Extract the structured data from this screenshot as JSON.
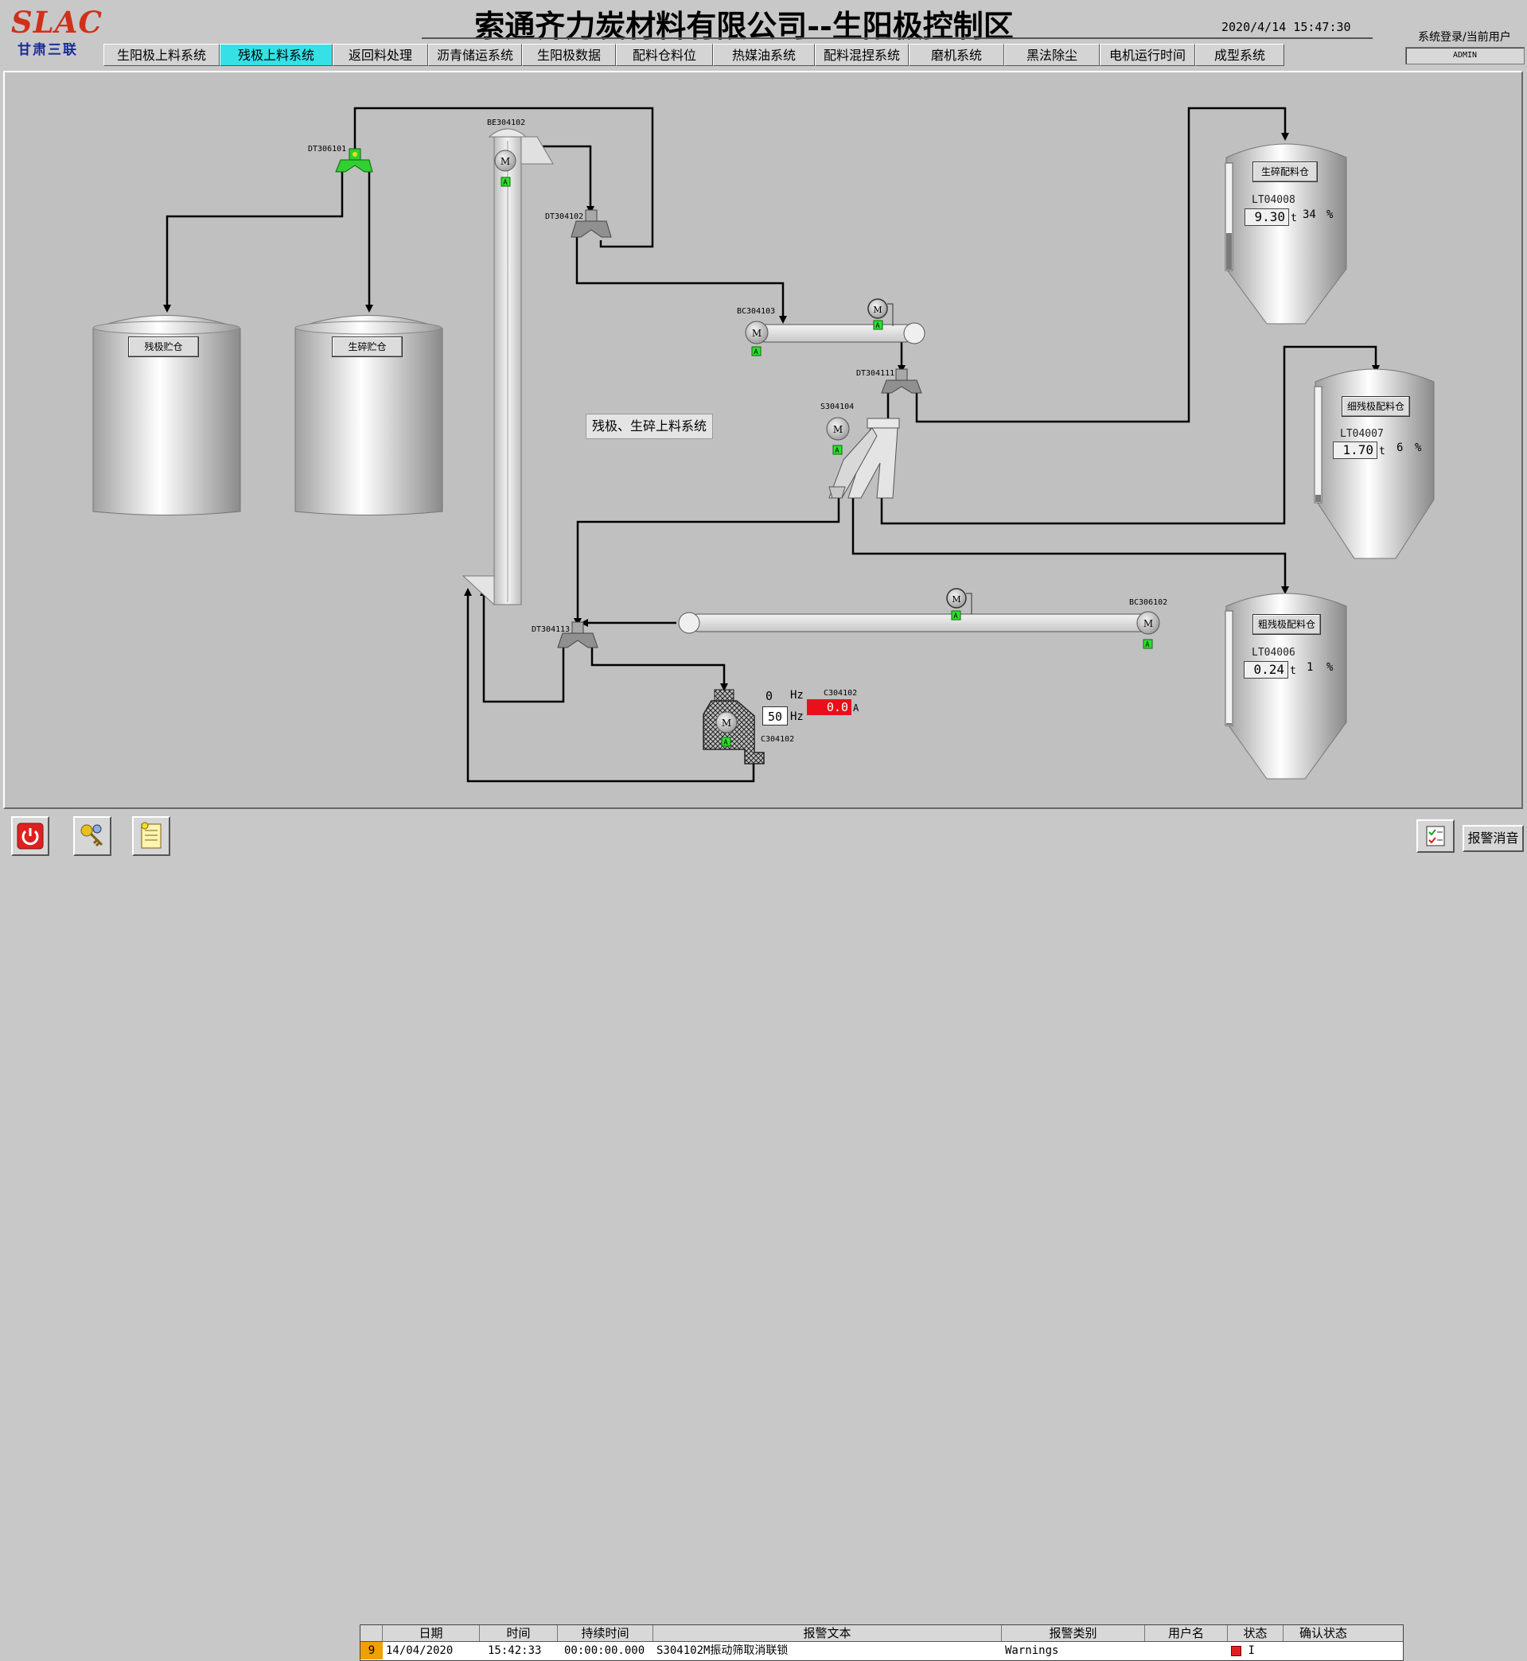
{
  "header": {
    "logo": "SLAC",
    "logo_sub": "甘肃三联",
    "title": "索通齐力炭材料有限公司--生阳极控制区",
    "datetime": "2020/4/14 15:47:30",
    "login_label": "系统登录/当前用户",
    "current_user": "ADMIN"
  },
  "tabs": [
    {
      "label": "生阳极上料系统",
      "active": false
    },
    {
      "label": "残极上料系统",
      "active": true
    },
    {
      "label": "返回料处理",
      "active": false
    },
    {
      "label": "沥青储运系统",
      "active": false
    },
    {
      "label": "生阳极数据",
      "active": false
    },
    {
      "label": "配料仓料位",
      "active": false
    },
    {
      "label": "热媒油系统",
      "active": false
    },
    {
      "label": "配料混捏系统",
      "active": false
    },
    {
      "label": "磨机系统",
      "active": false
    },
    {
      "label": "黑法除尘",
      "active": false
    },
    {
      "label": "电机运行时间",
      "active": false
    },
    {
      "label": "成型系统",
      "active": false
    }
  ],
  "equipment": {
    "dt306101": "DT306101",
    "be304102": "BE304102",
    "dt304102": "DT304102",
    "bc304103": "BC304103",
    "dt304111": "DT304111",
    "s304104": "S304104",
    "dt304113": "DT304113",
    "bc306102": "BC306102",
    "c304102_top": "C304102",
    "c304102_bottom": "C304102",
    "motor_letter": "M",
    "status_letter": "A"
  },
  "storage": {
    "bin1_label": "残极贮仓",
    "bin2_label": "生碎贮仓"
  },
  "system_label": "残极、生碎上料系统",
  "silos": [
    {
      "label": "生碎配料仓",
      "tag": "LT04008",
      "value": "9.30",
      "unit": "t",
      "percent": "34",
      "pct_unit": "%",
      "level": 0.34
    },
    {
      "label": "细残极配料仓",
      "tag": "LT04007",
      "value": "1.70",
      "unit": "t",
      "percent": "6",
      "pct_unit": "%",
      "level": 0.06
    },
    {
      "label": "粗残极配料仓",
      "tag": "LT04006",
      "value": "0.24",
      "unit": "t",
      "percent": "1",
      "pct_unit": "%",
      "level": 0.01
    }
  ],
  "crusher": {
    "freq_actual": "0",
    "freq_unit": "Hz",
    "freq_set": "50",
    "freq_set_unit": "Hz",
    "current": "0.0",
    "current_unit": "A"
  },
  "alarm": {
    "headers": [
      "日期",
      "时间",
      "持续时间",
      "报警文本",
      "报警类别",
      "用户名",
      "状态",
      "确认状态"
    ],
    "row": {
      "index": "9",
      "date": "14/04/2020",
      "time": "15:42:33",
      "duration": "00:00:00.000",
      "text": "S304102M振动筛取消联锁",
      "category": "Warnings",
      "user": "",
      "state": "I",
      "ack": ""
    },
    "ack_button": "报警消音"
  },
  "colors": {
    "active_tab": "#36e1e6",
    "status_green": "#2ee02e",
    "alarm_red": "#e8101a",
    "index_cell": "#f0a000"
  }
}
